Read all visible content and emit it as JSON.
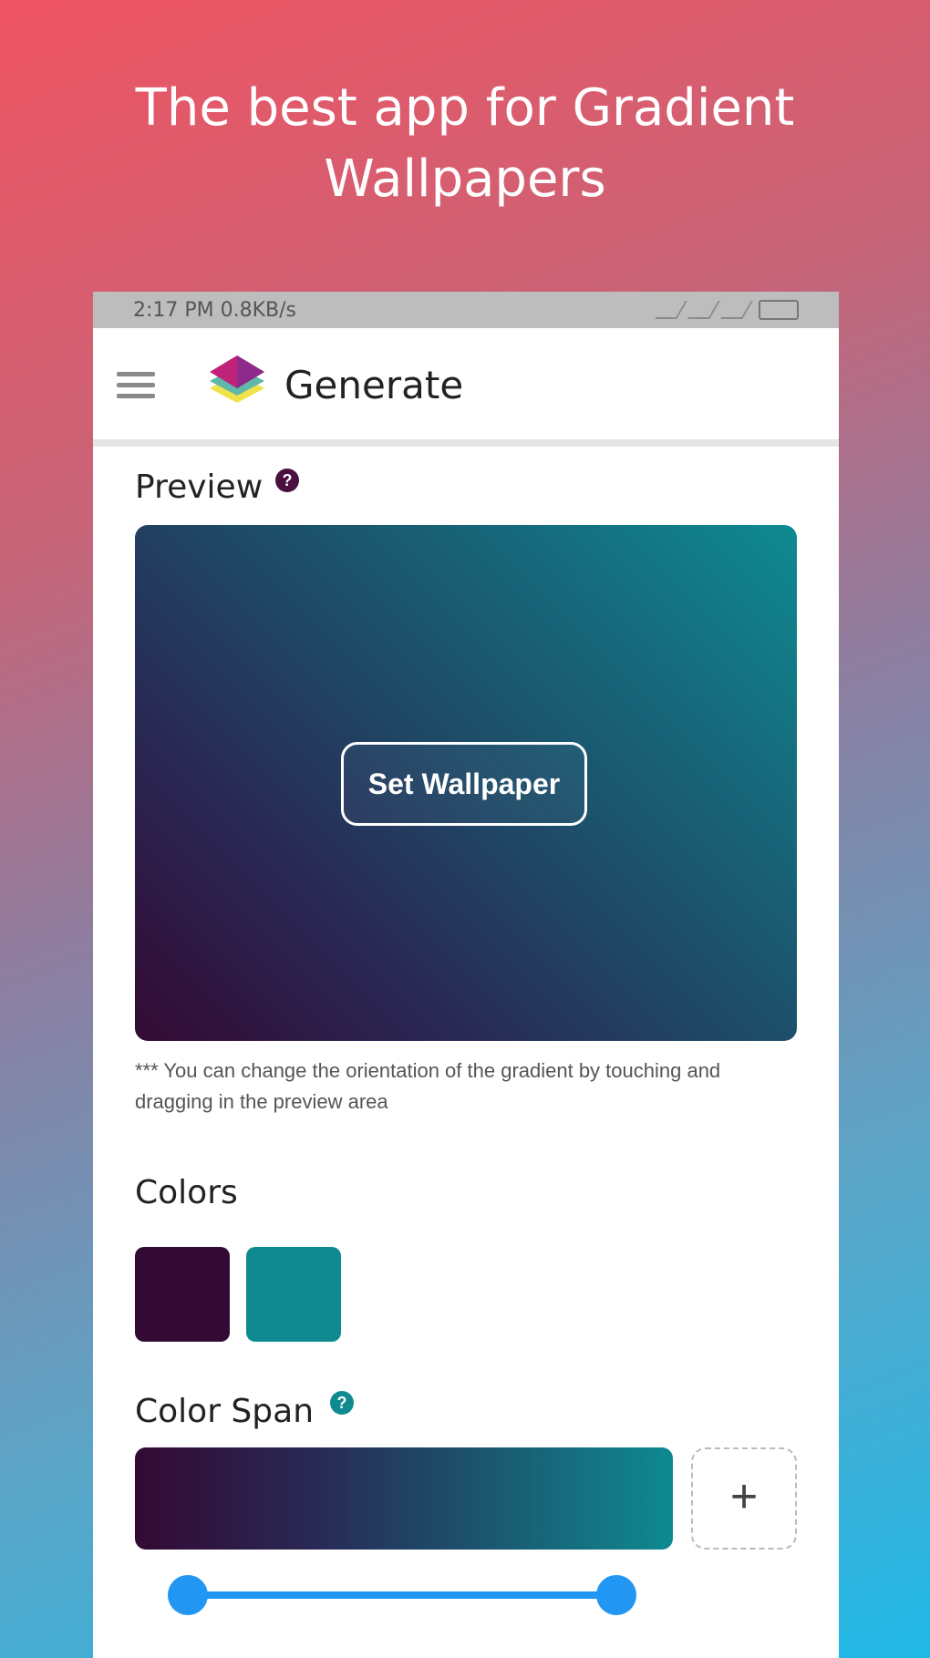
{
  "promo": {
    "headline_line1": "The best app for Gradient",
    "headline_line2": "Wallpapers"
  },
  "status_bar": {
    "time_info": "2:17 PM  0.8KB/s"
  },
  "app_bar": {
    "title": "Generate"
  },
  "preview": {
    "label": "Preview",
    "help": "?",
    "set_wallpaper_label": "Set Wallpaper",
    "note": "*** You can change the orientation of the gradient by touching and dragging in the preview area"
  },
  "colors": {
    "label": "Colors",
    "swatches": [
      "#330a33",
      "#0e8a90"
    ]
  },
  "color_span": {
    "label": "Color Span",
    "help": "?",
    "add_label": "+",
    "range": [
      0.0,
      1.0
    ]
  }
}
